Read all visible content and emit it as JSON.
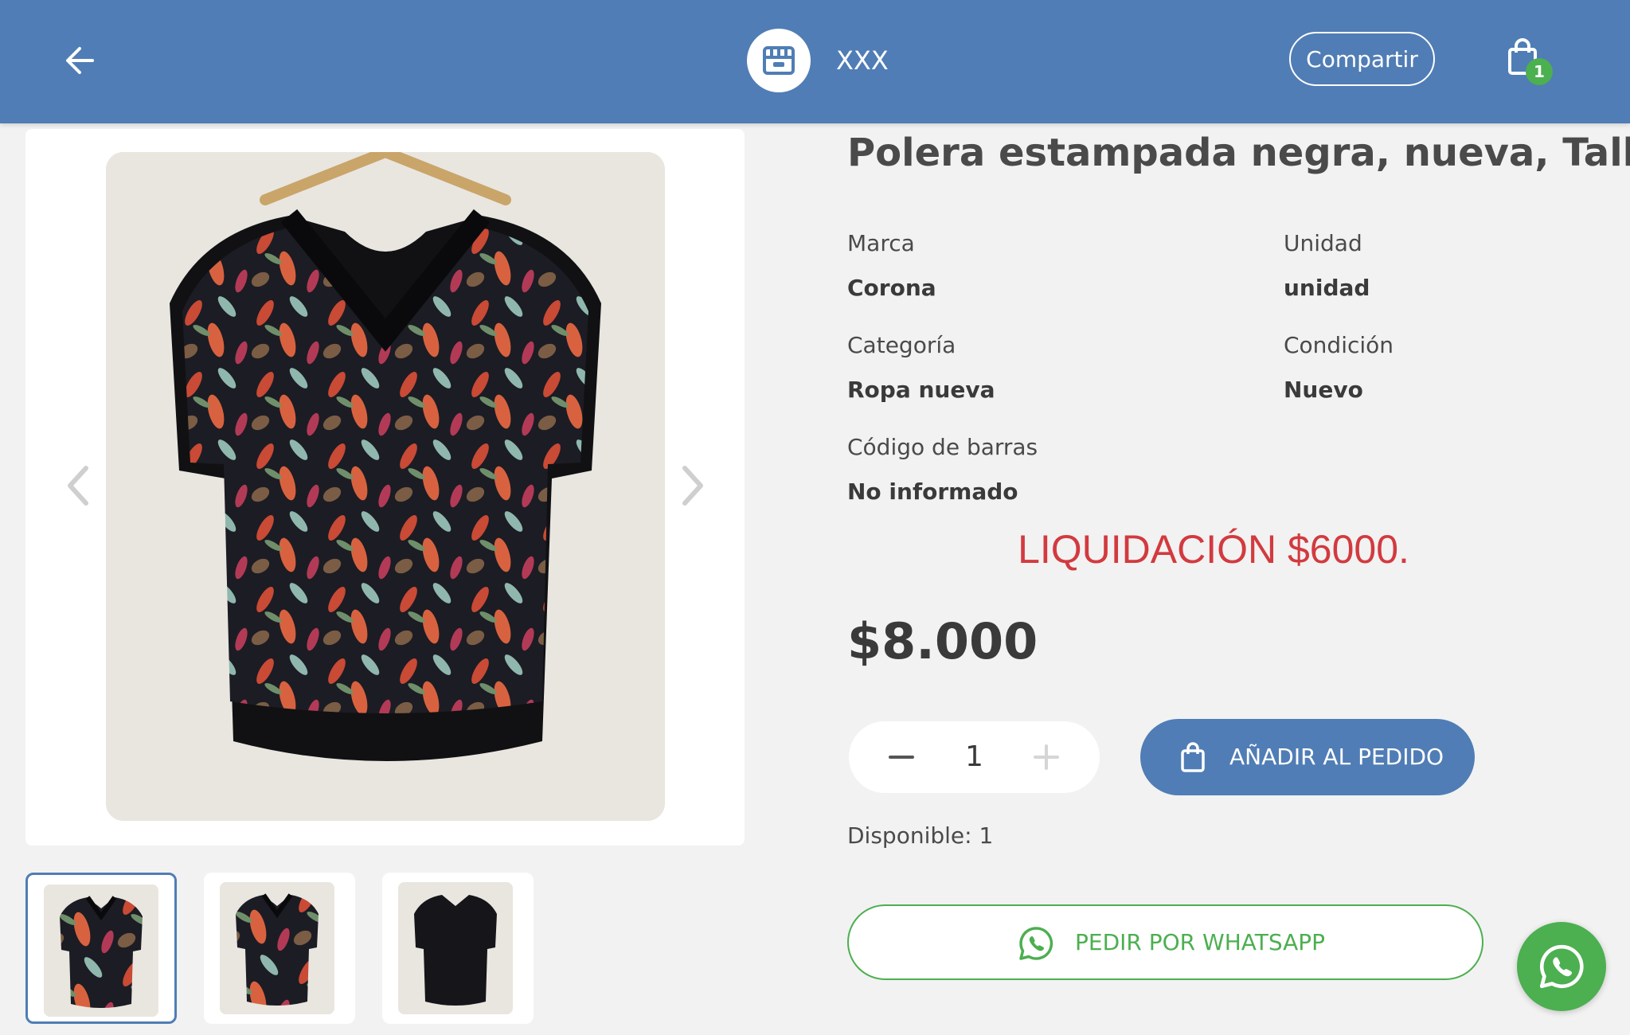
{
  "header": {
    "store_name": "XXX",
    "share_label": "Compartir",
    "cart_count": "1",
    "background_color": "#507db5"
  },
  "icons": [
    "back-arrow-icon",
    "store-icon",
    "shopping-bag-icon",
    "chevron-left-icon",
    "chevron-right-icon",
    "minus-icon",
    "plus-icon",
    "whatsapp-icon"
  ],
  "product": {
    "title": "Polera estampada negra, nueva, Talla L",
    "attributes": {
      "brand_label": "Marca",
      "brand_value": "Corona",
      "unit_label": "Unidad",
      "unit_value": "unidad",
      "category_label": "Categoría",
      "category_value": "Ropa nueva",
      "condition_label": "Condición",
      "condition_value": "Nuevo",
      "barcode_label": "Código de barras",
      "barcode_value": "No informado"
    },
    "promo_text": "LIQUIDACIÓN $6000.",
    "price": "$8.000",
    "quantity": "1",
    "add_to_order_label": "AÑADIR AL PEDIDO",
    "stock_text": "Disponible: 1",
    "whatsapp_order_label": "PEDIR POR WHATSAPP"
  },
  "gallery": {
    "thumbnail_count": 3,
    "active_index": 0
  },
  "colors": {
    "primary": "#507db5",
    "promo_red": "#d23a3f",
    "whatsapp_green": "#4caf50"
  }
}
